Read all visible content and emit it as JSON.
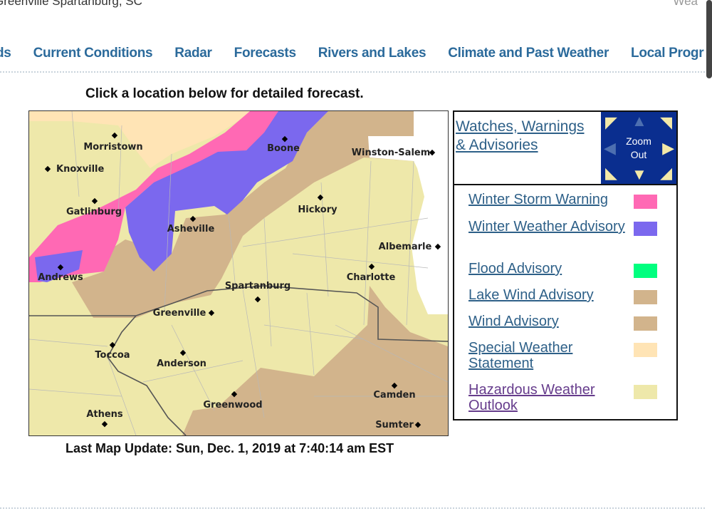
{
  "header": {
    "title": "Greenville Spartanburg, SC",
    "right_text": "Wea"
  },
  "nav": [
    "ds",
    "Current Conditions",
    "Radar",
    "Forecasts",
    "Rivers and Lakes",
    "Climate and Past Weather",
    "Local Progr"
  ],
  "heading": "Click a location below for detailed forecast.",
  "map": {
    "last_update": "Last Map Update: Sun, Dec. 1, 2019 at 7:40:14 am EST",
    "cities": [
      "Morristown",
      "Knoxville",
      "Gatlinburg",
      "Boone",
      "Winston-Salem",
      "Hickory",
      "Asheville",
      "Albemarle",
      "Andrews",
      "Charlotte",
      "Spartanburg",
      "Greenville",
      "Toccoa",
      "Anderson",
      "Greenwood",
      "Camden",
      "Athens",
      "Sumter"
    ]
  },
  "legend": {
    "title": "Watches, Warnings & Advisories",
    "zoom_label": "Zoom Out",
    "items": [
      {
        "label": "Winter Storm Warning",
        "color": "#ff69b4"
      },
      {
        "label": "Winter Weather Advisory",
        "color": "#7b68ee"
      },
      {
        "label": "Flood Advisory",
        "color": "#00ff7f"
      },
      {
        "label": "Lake Wind Advisory",
        "color": "#d2b48c"
      },
      {
        "label": "Wind Advisory",
        "color": "#d2b48c"
      },
      {
        "label": "Special Weather Statement",
        "color": "#ffe4b5"
      },
      {
        "label": "Hazardous Weather Outlook",
        "color": "#eee8aa"
      }
    ]
  }
}
